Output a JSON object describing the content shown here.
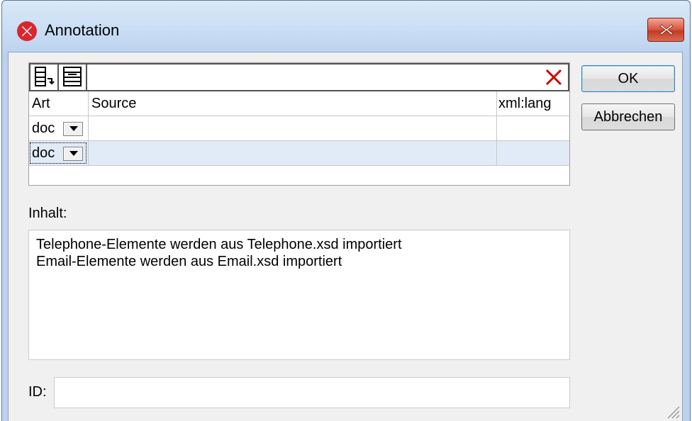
{
  "window": {
    "title": "Annotation"
  },
  "toolbar": {
    "append_row_icon": "append-row-icon",
    "insert_row_icon": "insert-row-icon",
    "delete_icon": "delete-x-icon"
  },
  "table": {
    "columns": [
      "Art",
      "Source",
      "xml:lang"
    ],
    "rows": [
      {
        "art": "doc",
        "source": "",
        "xml_lang": ""
      },
      {
        "art": "doc",
        "source": "",
        "xml_lang": ""
      }
    ]
  },
  "content": {
    "label": "Inhalt:",
    "lines": [
      "Telephone-Elemente werden aus Telephone.xsd importiert",
      "Email-Elemente werden aus Email.xsd importiert"
    ]
  },
  "id_field": {
    "label": "ID:",
    "value": ""
  },
  "buttons": {
    "ok": "OK",
    "cancel": "Abbrechen"
  },
  "colors": {
    "selected_row": "#e1ebf8",
    "close_button": "#c9432b",
    "delete_icon": "#cc0000"
  }
}
